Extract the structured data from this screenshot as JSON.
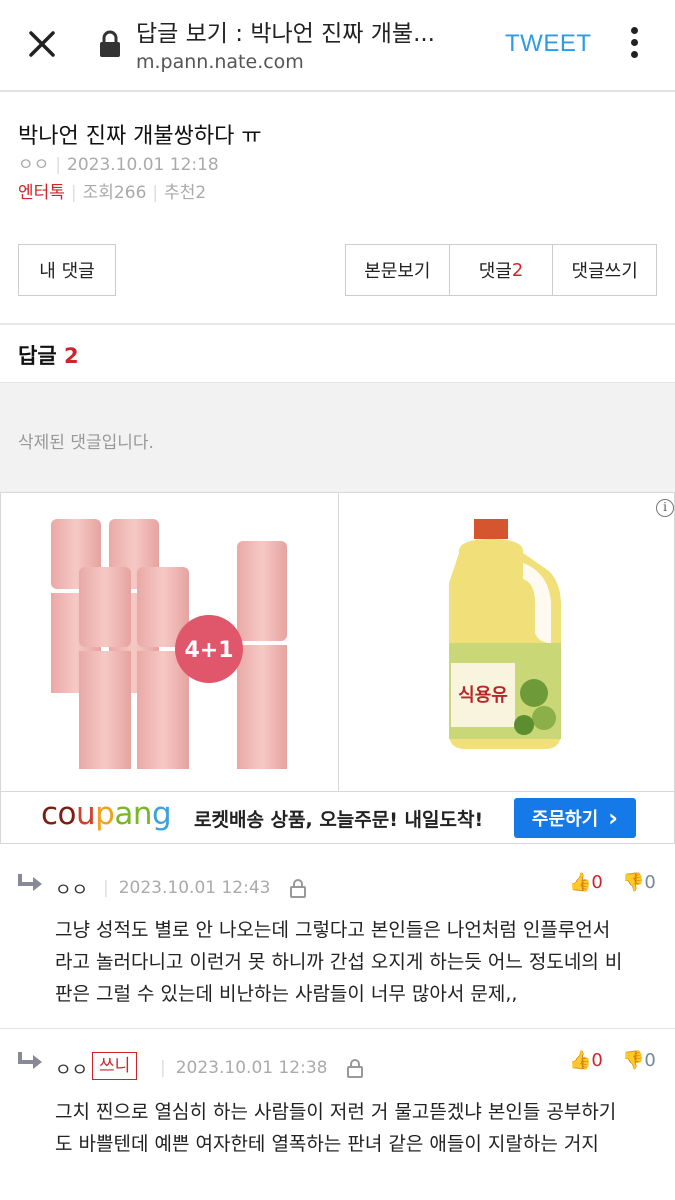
{
  "browser": {
    "title": "답글 보기 : 박나언 진짜 개불...",
    "url": "m.pann.nate.com",
    "tweet_label": "TWEET"
  },
  "article": {
    "title": "박나언 진짜 개불쌍하다 ㅠ",
    "author": "ㅇㅇ",
    "datetime": "2023.10.01 12:18",
    "category": "엔터톡",
    "views": "조회266",
    "recommends": "추천2"
  },
  "buttons": {
    "my_comments": "내 댓글",
    "view_post": "본문보기",
    "comments": "댓글",
    "comments_count": "2",
    "write_comment": "댓글쓰기"
  },
  "replies": {
    "label": "답글",
    "count": "2",
    "deleted_text": "삭제된 댓글입니다."
  },
  "ad": {
    "info_icon": "i",
    "badge": "4+1",
    "oil_label": "식용유",
    "brand_parts": [
      "co",
      "u",
      "p",
      "an",
      "g"
    ],
    "text": "로켓배송 상품, 오늘주문! 내일도착!",
    "button": "주문하기",
    "button_arrow": "›"
  },
  "comments": [
    {
      "nick": "ㅇㅇ",
      "badge": "",
      "datetime": "2023.10.01 12:43",
      "likes": "0",
      "dislikes": "0",
      "lines": [
        "그냥 성적도 별로 안 나오는데 그렇다고 본인들은 나언처럼 인플루언서",
        "라고 놀러다니고 이런거 못 하니까 간섭 오지게 하는듯 어느 정도네의 비",
        "판은 그럴 수 있는데 비난하는 사람들이 너무 많아서 문제,,"
      ]
    },
    {
      "nick": "ㅇㅇ",
      "badge": "쓰니",
      "datetime": "2023.10.01 12:38",
      "likes": "0",
      "dislikes": "0",
      "lines": [
        "그치 찐으로 열심히 하는 사람들이 저런 거 물고뜯겠냐 본인들 공부하기",
        "도 바쁠텐데 예쁜 여자한테 열폭하는 판녀 같은 애들이 지랄하는 거지"
      ]
    }
  ],
  "colors": {
    "accent_red": "#d2232a",
    "tweet_blue": "#2f9be3",
    "order_blue": "#1679e8"
  }
}
